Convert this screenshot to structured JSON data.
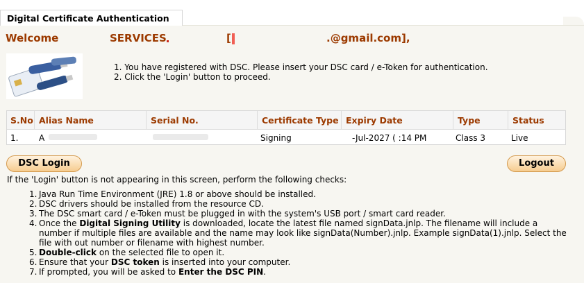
{
  "tab": {
    "title": "Digital Certificate Authentication"
  },
  "welcome": {
    "prefix": "Welcome",
    "services": "SERVICES",
    "bracket_open": "[",
    "email": ".@gmail.com],"
  },
  "intro": {
    "line1": "1. You have registered with DSC. Please insert your DSC card / e-Token for authentication.",
    "line2": "2. Click the 'Login' button to proceed."
  },
  "table": {
    "headers": [
      "S.No",
      "Alias Name",
      "Serial No.",
      "Certificate Type",
      "Expiry Date",
      "Type",
      "Status"
    ],
    "row": {
      "sno": "1.",
      "alias": "A",
      "serial": "",
      "cert_type": "Signing",
      "expiry": "-Jul-2027 (  :14 PM",
      "type": "Class 3",
      "status": "Live"
    }
  },
  "buttons": {
    "login": "DSC Login",
    "logout": "Logout"
  },
  "note": "If the 'Login' button is not appearing in this screen, perform the following checks:",
  "checks": [
    {
      "num": "1.",
      "parts": [
        {
          "t": "Java Run Time Environment (JRE) 1.8 or above should be installed."
        }
      ]
    },
    {
      "num": "2.",
      "parts": [
        {
          "t": "DSC drivers should be installed from the resource CD."
        }
      ]
    },
    {
      "num": "3.",
      "parts": [
        {
          "t": "The DSC smart card / e-Token must be plugged in with the system's USB port / smart card reader."
        }
      ]
    },
    {
      "num": "4.",
      "parts": [
        {
          "t": "Once the "
        },
        {
          "t": "Digital Signing Utility",
          "b": true
        },
        {
          "t": " is downloaded, locate the latest file named signData.jnlp. The filename will include a number if multiple files are available and the name may look like signData(Number).jnlp. Example signData(1).jnlp. Select the file with out number or filename with highest number."
        }
      ]
    },
    {
      "num": "5.",
      "parts": [
        {
          "t": "Double-click",
          "b": true
        },
        {
          "t": " on the selected file to open it."
        }
      ]
    },
    {
      "num": "6.",
      "parts": [
        {
          "t": "Ensure that your "
        },
        {
          "t": "DSC token",
          "b": true
        },
        {
          "t": " is inserted into your computer."
        }
      ]
    },
    {
      "num": "7.",
      "parts": [
        {
          "t": "If prompted, you will be asked to "
        },
        {
          "t": "Enter the DSC PIN",
          "b": true
        },
        {
          "t": "."
        }
      ]
    }
  ]
}
